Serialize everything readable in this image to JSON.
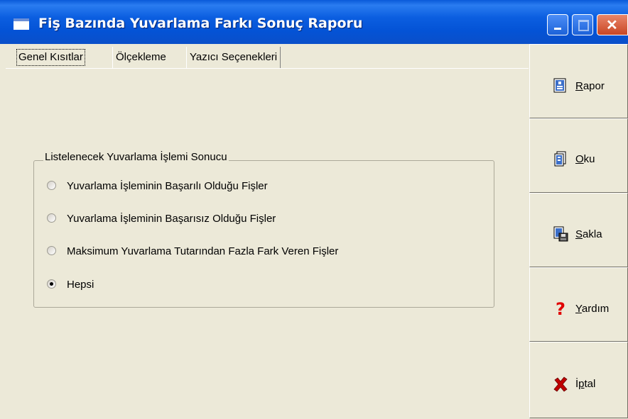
{
  "window": {
    "title": "Fiş Bazında Yuvarlama Farkı Sonuç Raporu"
  },
  "tabs": [
    {
      "label": "Genel Kısıtlar",
      "selected": true
    },
    {
      "label": "Ölçekleme",
      "selected": false
    },
    {
      "label": "Yazıcı Seçenekleri",
      "selected": false
    }
  ],
  "group": {
    "title": "Listelenecek Yuvarlama İşlemi Sonucu",
    "options": [
      {
        "label": "Yuvarlama İşleminin Başarılı Olduğu Fişler",
        "checked": false
      },
      {
        "label": "Yuvarlama İşleminin Başarısız Olduğu Fişler",
        "checked": false
      },
      {
        "label": "Maksimum Yuvarlama Tutarından Fazla Fark Veren Fişler",
        "checked": false
      },
      {
        "label": "Hepsi",
        "checked": true
      }
    ]
  },
  "side_buttons": [
    {
      "mnemonic": "R",
      "rest": "apor",
      "icon": "report-icon"
    },
    {
      "mnemonic": "O",
      "rest": "ku",
      "icon": "read-icon"
    },
    {
      "mnemonic": "S",
      "rest": "akla",
      "icon": "save-icon"
    },
    {
      "mnemonic": "Y",
      "rest": "ardım",
      "icon": "help-icon"
    },
    {
      "pre": "İ",
      "mnemonic": "p",
      "rest": "tal",
      "icon": "cancel-icon"
    }
  ]
}
